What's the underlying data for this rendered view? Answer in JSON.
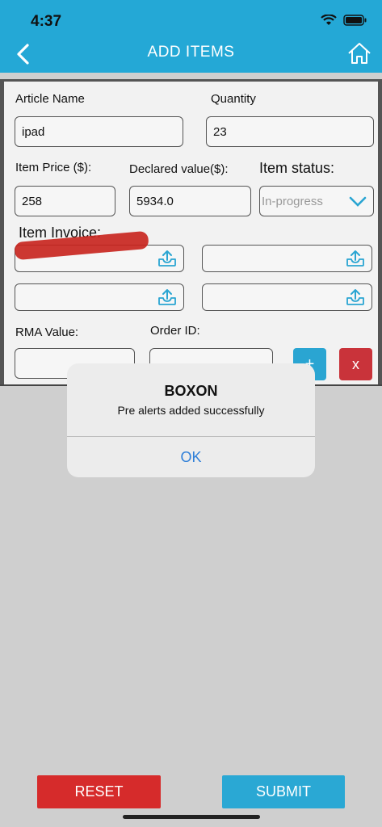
{
  "status_bar": {
    "time": "4:37"
  },
  "nav": {
    "title": "ADD ITEMS",
    "back_icon": "chevron-left-icon",
    "home_icon": "home-icon"
  },
  "form": {
    "article_name_label": "Article Name",
    "article_name_value": "ipad",
    "quantity_label": "Quantity",
    "quantity_value": "23",
    "item_price_label": "Item Price ($):",
    "item_price_value": "258",
    "declared_value_label": "Declared value($):",
    "declared_value_value": "5934.0",
    "item_status_label": "Item status:",
    "item_status_value": "In-progress",
    "item_invoice_label": "Item Invoice:",
    "rma_label": "RMA Value:",
    "order_id_label": "Order ID:",
    "add_button": "+",
    "remove_button": "x"
  },
  "dialog": {
    "title": "BOXON",
    "message": "Pre alerts added successfully",
    "ok_label": "OK"
  },
  "actions": {
    "reset_label": "RESET",
    "submit_label": "SUBMIT"
  },
  "colors": {
    "header": "#24a8d6",
    "reset": "#d62b2b",
    "submit": "#2aa8d4",
    "link": "#2f7fd8"
  }
}
